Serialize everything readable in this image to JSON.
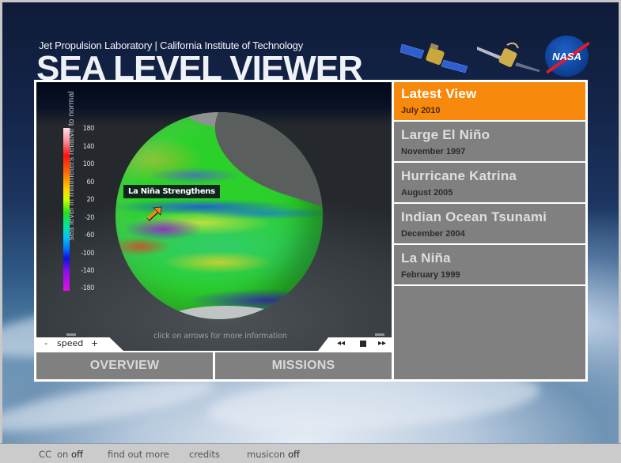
{
  "header": {
    "institution": "Jet Propulsion Laboratory | California Institute of Technology",
    "title": "SEA LEVEL VIEWER",
    "logos": [
      "satellite-jason-icon",
      "satellite-topex-icon",
      "nasa-logo"
    ],
    "nasa_text": "NASA"
  },
  "viewer": {
    "colorbar": {
      "label": "sea level in millimeters relative to normal",
      "ticks": [
        "180",
        "140",
        "100",
        "60",
        "20",
        "-20",
        "-60",
        "-100",
        "-140",
        "-180"
      ]
    },
    "callout": "La Niña Strengthens",
    "hint": "click on arrows for more information",
    "speed": {
      "minus": "-",
      "label": "speed",
      "plus": "+"
    },
    "playback": {
      "rewind": "◂◂",
      "stop": "stop",
      "forward": "▸▸"
    }
  },
  "nav": {
    "overview": "OVERVIEW",
    "missions": "MISSIONS"
  },
  "events": [
    {
      "title": "Latest View",
      "date": "July 2010",
      "active": true
    },
    {
      "title": "Large El Niño",
      "date": "November 1997",
      "active": false
    },
    {
      "title": "Hurricane Katrina",
      "date": "August 2005",
      "active": false
    },
    {
      "title": "Indian Ocean Tsunami",
      "date": "December 2004",
      "active": false
    },
    {
      "title": "La Niña",
      "date": "February 1999",
      "active": false
    }
  ],
  "colors": {
    "accent": "#f7890c",
    "button_gray": "#808080"
  },
  "footer": {
    "cc_label": "CC",
    "cc_on": "on",
    "cc_off": "off",
    "find_out_more": "find out more",
    "credits": "credits",
    "music_label": "music",
    "music_on": "on",
    "music_off": "off"
  }
}
